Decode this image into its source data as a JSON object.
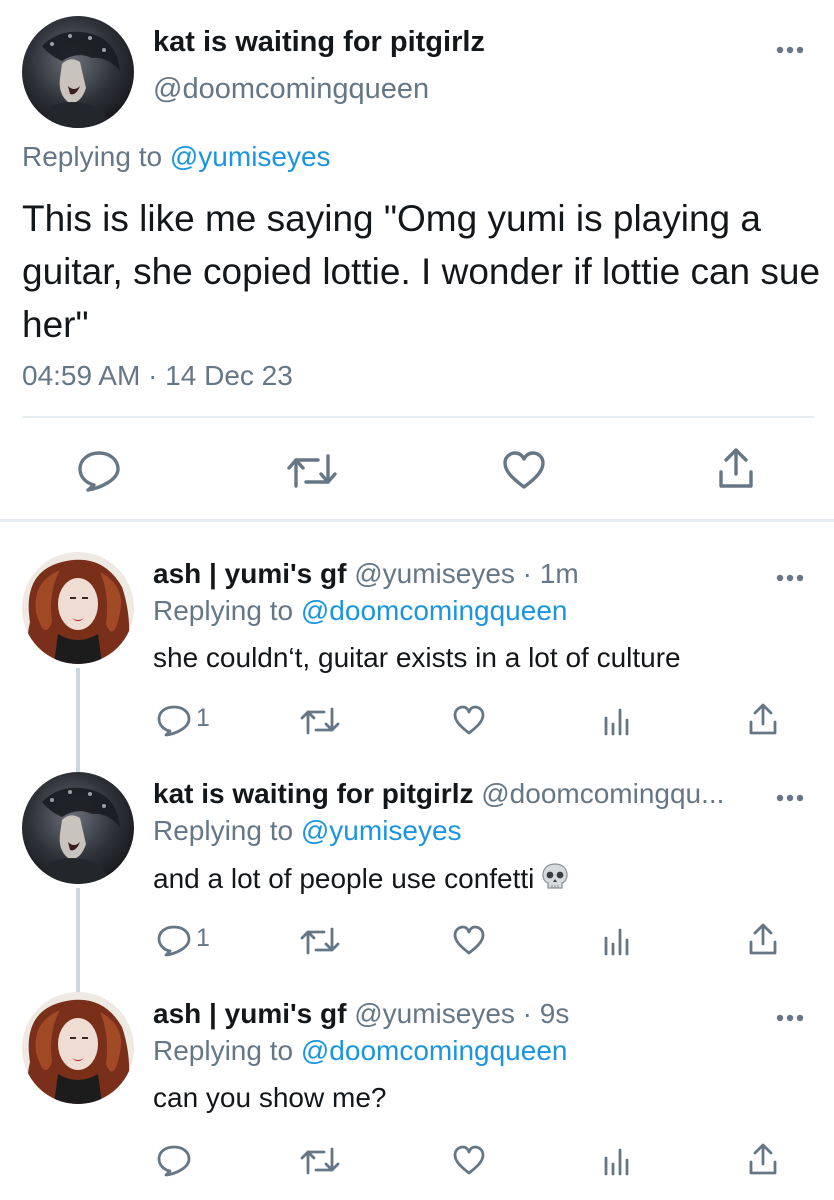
{
  "main_tweet": {
    "display_name": "kat is waiting for pitgirlz",
    "handle": "@doomcomingqueen",
    "replying_prefix": "Replying to",
    "replying_to": "@yumiseyes",
    "text": "This is like me saying \"Omg yumi is playing a guitar, she copied lottie. I wonder if lottie can sue her\"",
    "timestamp": "04:59 AM · 14 Dec 23",
    "actions": [
      "reply-icon",
      "retweet-icon",
      "like-icon",
      "share-icon"
    ]
  },
  "replies": [
    {
      "display_name": "ash | yumi's gf",
      "meta": "@yumiseyes · 1m",
      "replying_prefix": "Replying to",
      "replying_to": "@doomcomingqueen",
      "text": "she couldn‘t, guitar exists in a lot of culture",
      "reply_count": "1"
    },
    {
      "display_name": "kat is waiting for pitgirlz",
      "meta": "@doomcomingqu...",
      "replying_prefix": "Replying to",
      "replying_to": "@yumiseyes",
      "text": "and a lot of people use confetti",
      "emoji": "skull-emoji",
      "reply_count": "1"
    },
    {
      "display_name": "ash | yumi's gf",
      "meta": "@yumiseyes · 9s",
      "replying_prefix": "Replying to",
      "replying_to": "@doomcomingqueen",
      "text": "can you show me?",
      "reply_count": ""
    }
  ],
  "colors": {
    "link": "#1b95e0",
    "secondary_text": "#657786",
    "divider": "#e6ecf0",
    "thread_line": "#ccd6dd"
  }
}
